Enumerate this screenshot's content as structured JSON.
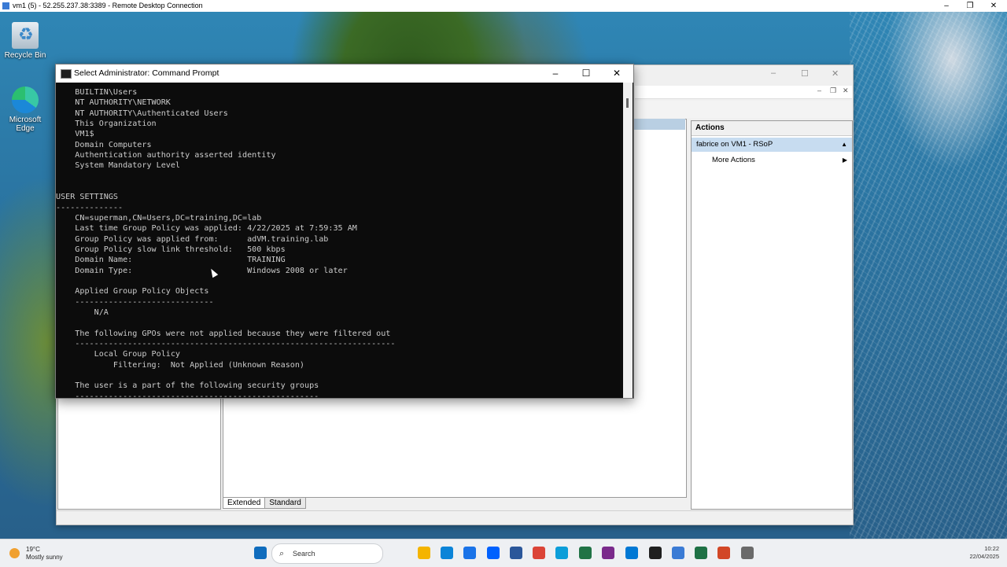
{
  "rdp": {
    "title": "vm1 (5) - 52.255.237.38:3389 - Remote Desktop Connection"
  },
  "desktop": {
    "icons": [
      {
        "label": "Recycle Bin"
      },
      {
        "label": "Microsoft Edge"
      }
    ]
  },
  "mmc": {
    "actions_header": "Actions",
    "selected_action": "fabrice on VM1 - RSoP",
    "more_actions": "More Actions",
    "tabs": [
      "Extended",
      "Standard"
    ]
  },
  "cmd": {
    "title": "Select Administrator: Command Prompt",
    "lines": [
      "    BUILTIN\\Users",
      "    NT AUTHORITY\\NETWORK",
      "    NT AUTHORITY\\Authenticated Users",
      "    This Organization",
      "    VM1$",
      "    Domain Computers",
      "    Authentication authority asserted identity",
      "    System Mandatory Level",
      "",
      "",
      "USER SETTINGS",
      "--------------",
      "    CN=superman,CN=Users,DC=training,DC=lab",
      "    Last time Group Policy was applied: 4/22/2025 at 7:59:35 AM",
      "    Group Policy was applied from:      adVM.training.lab",
      "    Group Policy slow link threshold:   500 kbps",
      "    Domain Name:                        TRAINING",
      "    Domain Type:                        Windows 2008 or later",
      "",
      "    Applied Group Policy Objects",
      "    -----------------------------",
      "        N/A",
      "",
      "    The following GPOs were not applied because they were filtered out",
      "    -------------------------------------------------------------------",
      "        Local Group Policy",
      "            Filtering:  Not Applied (Unknown Reason)",
      "",
      "    The user is a part of the following security groups",
      "    ---------------------------------------------------"
    ]
  },
  "taskbar": {
    "weather_temp": "19°C",
    "weather_condition": "Mostly sunny",
    "search_placeholder": "Search",
    "time": "10:22",
    "date": "22/04/2025",
    "icon_colors": [
      "#0f6cbd",
      "#1f1f1f",
      "#f4b400",
      "#0b84d8",
      "#1a73e8",
      "#0061fe",
      "#2b579a",
      "#db4437",
      "#0c9ed9",
      "#217346",
      "#7a2a8b",
      "#0078d4",
      "#1f1f1f",
      "#3a7bd5",
      "#1e7145",
      "#d24726",
      "#6a6a6a"
    ]
  }
}
